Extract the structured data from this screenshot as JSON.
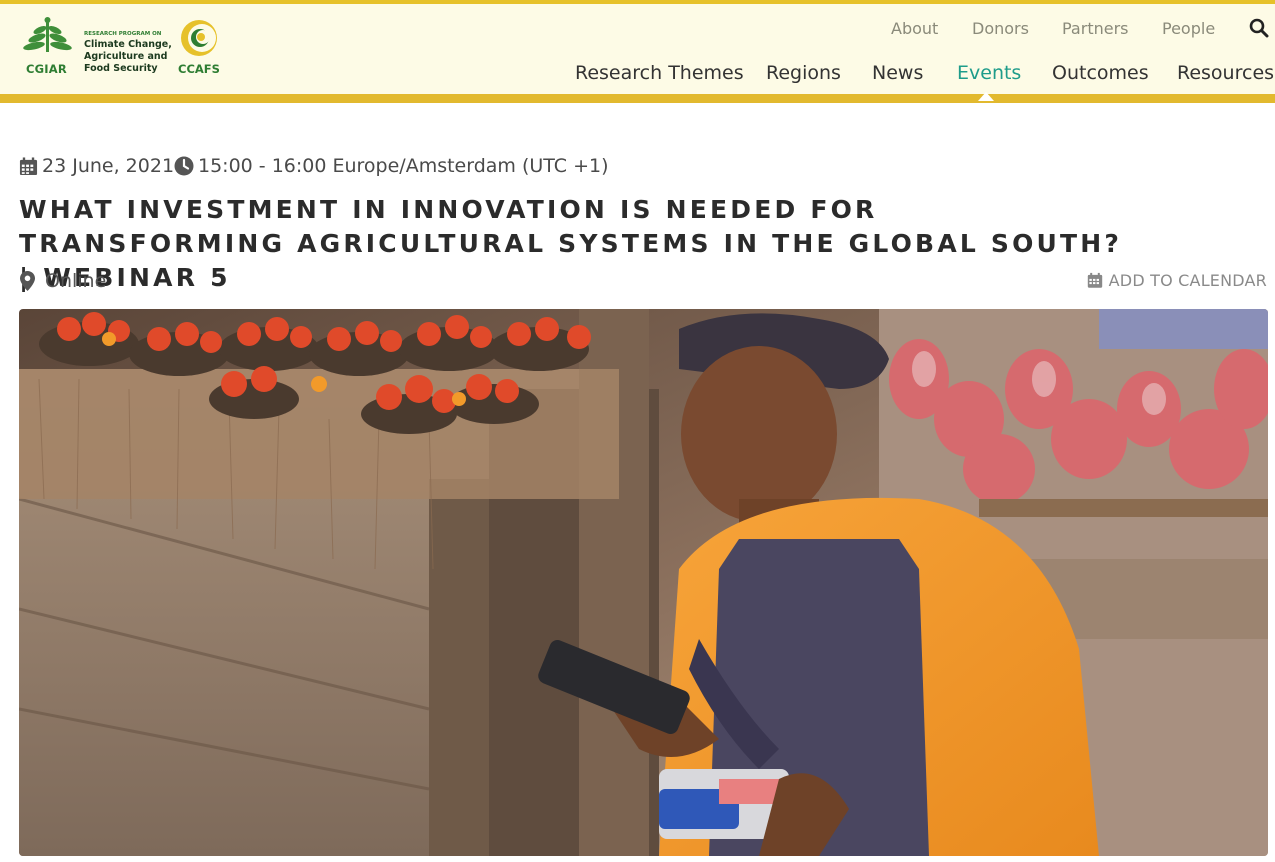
{
  "brand": {
    "org_name": "CGIAR",
    "program_small": "RESEARCH PROGRAM ON",
    "program_name": "Climate Change, Agriculture and Food Security",
    "program_acronym": "CCAFS",
    "colors": {
      "header_bg": "#fdfbe6",
      "accent_yellow": "#e2b92e",
      "green": "#2e7d32",
      "active_teal": "#1e9c8a"
    }
  },
  "top_nav": {
    "items": [
      {
        "label": "About"
      },
      {
        "label": "Donors"
      },
      {
        "label": "Partners"
      },
      {
        "label": "People"
      }
    ],
    "search_icon": "search-icon"
  },
  "main_nav": {
    "items": [
      {
        "label": "Research Themes"
      },
      {
        "label": "Regions"
      },
      {
        "label": "News"
      },
      {
        "label": "Events",
        "active": true
      },
      {
        "label": "Outcomes"
      },
      {
        "label": "Resources"
      }
    ]
  },
  "event": {
    "date": "23 June, 2021",
    "time": "15:00 - 16:00 Europe/Amsterdam (UTC +1)",
    "title": "WHAT INVESTMENT IN INNOVATION IS NEEDED FOR TRANSFORMING AGRICULTURAL SYSTEMS IN THE GLOBAL SOUTH? | WEBINAR 5",
    "location": "Online",
    "add_to_calendar": "ADD TO CALENDAR"
  }
}
